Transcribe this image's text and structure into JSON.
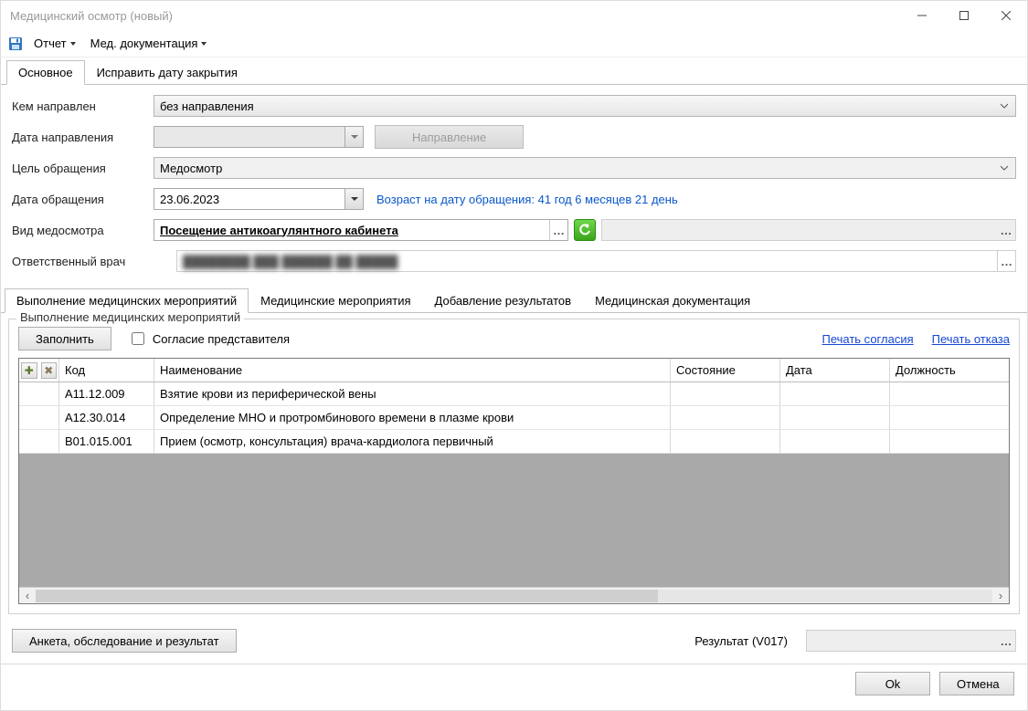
{
  "window": {
    "title": "Медицинский осмотр (новый)"
  },
  "toolbar": {
    "report_label": "Отчет",
    "meddoc_label": "Мед. документация"
  },
  "tabs": {
    "main": "Основное",
    "fixdate": "Исправить дату закрытия"
  },
  "form": {
    "referred_by_label": "Кем направлен",
    "referred_by_value": "без направления",
    "referral_date_label": "Дата направления",
    "referral_date_value": "",
    "referral_button": "Направление",
    "purpose_label": "Цель обращения",
    "purpose_value": "Медосмотр",
    "visit_date_label": "Дата обращения",
    "visit_date_value": "23.06.2023",
    "age_hint": "Возраст на дату обращения:  41 год 6 месяцев 21 день",
    "exam_type_label": "Вид медосмотра",
    "exam_type_value": "Посещение антикоагулянтного кабинета",
    "doctor_label": "Ответственный врач",
    "doctor_value": "████████ ███ ██████ ██ █████"
  },
  "subtabs": {
    "t1": "Выполнение медицинских мероприятий",
    "t2": "Медицинские мероприятия",
    "t3": "Добавление результатов",
    "t4": "Медицинская документация"
  },
  "group": {
    "title": "Выполнение медицинских мероприятий",
    "fill_btn": "Заполнить",
    "consent_chk": "Согласие представителя",
    "print_consent": "Печать согласия",
    "print_refusal": "Печать отказа"
  },
  "grid": {
    "headers": {
      "code": "Код",
      "name": "Наименование",
      "state": "Состояние",
      "date": "Дата",
      "role": "Должность"
    },
    "rows": [
      {
        "code": "A11.12.009",
        "name": "Взятие крови из периферической вены",
        "state": "",
        "date": "",
        "role": ""
      },
      {
        "code": "A12.30.014",
        "name": "Определение МНО и протромбинового времени в плазме крови",
        "state": "",
        "date": "",
        "role": ""
      },
      {
        "code": "B01.015.001",
        "name": "Прием (осмотр, консультация) врача-кардиолога первичный",
        "state": "",
        "date": "",
        "role": ""
      }
    ]
  },
  "bottom": {
    "survey_btn": "Анкета, обследование и результат",
    "result_label": "Результат (V017)",
    "result_value": ""
  },
  "footer": {
    "ok": "Ok",
    "cancel": "Отмена"
  }
}
